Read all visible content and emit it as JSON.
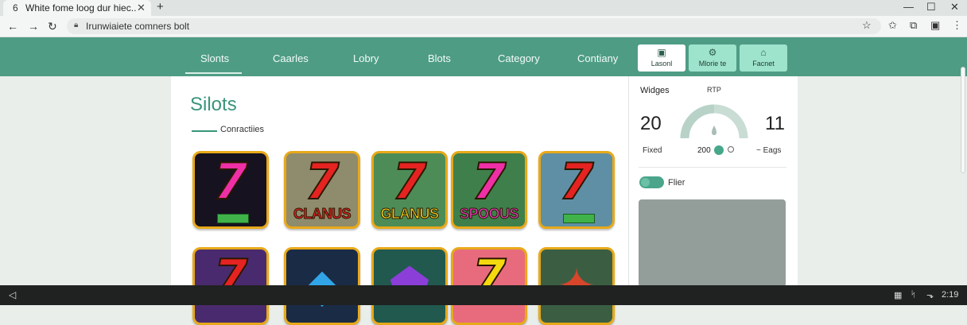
{
  "browser": {
    "tab_icon": "page-icon",
    "tab_icon_glyph": "6",
    "tab_title": "White fome loog dur hiec..",
    "close_glyph": "✕",
    "new_tab_glyph": "+",
    "minimize_glyph": "—",
    "maximize_glyph": "☐",
    "window_close_glyph": "✕",
    "back_glyph": "←",
    "forward_glyph": "→",
    "reload_glyph": "↻",
    "url": "Irunwiaiete comners bolt",
    "star_glyph": "☆",
    "extension_glyph": "✩",
    "puzzle_glyph": "⧉",
    "profile_glyph": "▣",
    "menu_glyph": "⋮"
  },
  "site_nav": {
    "items": [
      "Slonts",
      "Caarles",
      "Lobry",
      "Blots",
      "Category",
      "Contiany"
    ],
    "cards": [
      {
        "icon": "badge-icon",
        "glyph": "▣",
        "label": "Lasonl",
        "bg": "#ffffff"
      },
      {
        "icon": "gear-icon",
        "glyph": "⚙",
        "label": "Mlorie te",
        "bg": "#9ee3cc"
      },
      {
        "icon": "home-icon",
        "glyph": "⌂",
        "label": "Facnet",
        "bg": "#9ee3cc"
      }
    ]
  },
  "main": {
    "title": "Silots",
    "subtitle": "Conractiies",
    "tiles": [
      {
        "seven": "7",
        "seven_color": "#ef2fa6",
        "bg": "#16121f",
        "caption": "",
        "caption_color": "",
        "arrow": true
      },
      {
        "seven": "7",
        "seven_color": "#e52321",
        "bg": "#8f8b6d",
        "caption": "CLANUS",
        "caption_color": "#e52321",
        "arrow": false
      },
      {
        "seven": "7",
        "seven_color": "#e52321",
        "bg": "#4d8c56",
        "caption": "GLANUS",
        "caption_color": "#f2d21c",
        "arrow": false
      },
      {
        "seven": "7",
        "seven_color": "#ef2fa6",
        "bg": "#3f7f4b",
        "caption": "SPOOUS",
        "caption_color": "#e83bbf",
        "arrow": false
      },
      {
        "seven": "7",
        "seven_color": "#e52321",
        "bg": "#5f8fa5",
        "caption": "",
        "caption_color": "",
        "arrow": true
      },
      {
        "seven": "7",
        "seven_color": "#e52321",
        "bg": "#4a2a6e",
        "caption": "",
        "caption_color": "",
        "arrow": false
      },
      {
        "gem": "diamond-icon",
        "gem_glyph": "◆",
        "gem_color": "#31a5e8",
        "bg": "#1a2b45"
      },
      {
        "gem": "gem-icon",
        "gem_glyph": "⬟",
        "gem_color": "#8b3fd8",
        "bg": "#21594f"
      },
      {
        "seven": "7",
        "seven_color": "#f5d90f",
        "bg": "#e86b7d",
        "caption": "",
        "caption_color": "",
        "arrow": false
      },
      {
        "gem": "crystal-icon",
        "gem_glyph": "✦",
        "gem_color": "#d8452a",
        "bg": "#3b5e43"
      }
    ]
  },
  "side_panel": {
    "widgets_label": "Widges",
    "rtp_label": "RTP",
    "big_left": "20",
    "big_right": "11",
    "fixed_label": "Fixed",
    "gauge_value": "200",
    "gauge_level": 0.5,
    "eng_label": "~ Eags",
    "filter_label": "Flier",
    "filter_on": true
  },
  "taskbar": {
    "start_glyph": "◁",
    "tray_icon_1": "▦",
    "tray_icon_2": "ᛋ",
    "tray_icon_3": "⬎",
    "time": "2:19"
  }
}
